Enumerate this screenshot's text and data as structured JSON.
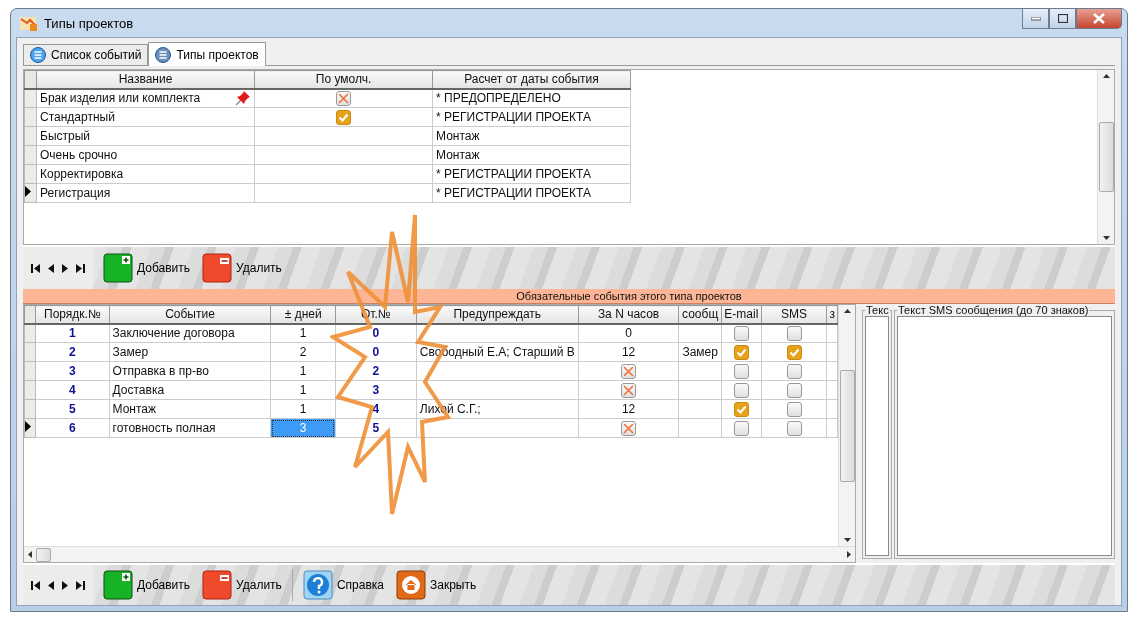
{
  "window": {
    "title": "Типы проектов"
  },
  "tabs": [
    {
      "label": "Список событий",
      "selected": false
    },
    {
      "label": "Типы проектов",
      "selected": true
    }
  ],
  "project_types": {
    "columns": [
      "Название",
      "По умолч.",
      "Расчет от даты события"
    ],
    "rows": [
      {
        "name": "Брак изделия или комплекта",
        "pinned": true,
        "default": {
          "kind": "cross"
        },
        "calc_from": "* ПРЕДОПРЕДЕЛЕНО",
        "selected": false
      },
      {
        "name": "Стандартный",
        "pinned": false,
        "default": {
          "kind": "check"
        },
        "calc_from": "* РЕГИСТРАЦИИ ПРОЕКТА",
        "selected": false
      },
      {
        "name": "Быстрый",
        "pinned": false,
        "calc_from": "Монтаж",
        "selected": false
      },
      {
        "name": "Очень срочно",
        "pinned": false,
        "calc_from": "Монтаж",
        "selected": false
      },
      {
        "name": "Корректировка",
        "pinned": false,
        "calc_from": "* РЕГИСТРАЦИИ ПРОЕКТА",
        "selected": false
      },
      {
        "name": "Регистрация",
        "pinned": false,
        "calc_from": "* РЕГИСТРАЦИИ ПРОЕКТА",
        "selected": true
      }
    ]
  },
  "top_toolbar": {
    "buttons": [
      {
        "kind": "add",
        "label": "Добавить"
      },
      {
        "kind": "delete",
        "label": "Удалить"
      }
    ]
  },
  "events_band": {
    "title": "Обязательные события этого типа проектов"
  },
  "events": {
    "columns": [
      "Порядк.№",
      "Событие",
      "± дней",
      "От.№",
      "Предупреждать",
      "За N часов",
      "сообщ",
      "E-mail",
      "SMS",
      "з"
    ],
    "rows": [
      {
        "order": "1",
        "event": "Заключение договора",
        "days": "1",
        "days_focused": false,
        "from": "0",
        "notify": "",
        "hours": {
          "kind": "text",
          "value": "0"
        },
        "message": "",
        "email": false,
        "sms": false,
        "selected": false
      },
      {
        "order": "2",
        "event": "Замер",
        "days": "2",
        "days_focused": false,
        "from": "0",
        "notify": "Свободный Е.А; Старший В",
        "hours": {
          "kind": "text",
          "value": "12"
        },
        "message": "Замер",
        "email": true,
        "sms": true,
        "selected": false
      },
      {
        "order": "3",
        "event": "Отправка в пр-во",
        "days": "1",
        "days_focused": false,
        "from": "2",
        "notify": "",
        "hours": {
          "kind": "cross"
        },
        "message": "",
        "email": false,
        "sms": false,
        "selected": false
      },
      {
        "order": "4",
        "event": "Доставка",
        "days": "1",
        "days_focused": false,
        "from": "3",
        "notify": "",
        "hours": {
          "kind": "cross"
        },
        "message": "",
        "email": false,
        "sms": false,
        "selected": false
      },
      {
        "order": "5",
        "event": "Монтаж",
        "days": "1",
        "days_focused": false,
        "from": "4",
        "notify": "Лихой С.Г.;",
        "hours": {
          "kind": "text",
          "value": "12"
        },
        "message": "",
        "email": true,
        "sms": false,
        "selected": false
      },
      {
        "order": "6",
        "event": "готовность полная",
        "days": "3",
        "days_focused": true,
        "from": "5",
        "notify": "",
        "hours": {
          "kind": "cross"
        },
        "message": "",
        "email": false,
        "sms": false,
        "selected": true
      }
    ]
  },
  "side_panels": [
    {
      "title": "Текс"
    },
    {
      "title": "Текст SMS сообщения (до 70 знаков)"
    }
  ],
  "bottom_toolbar": {
    "buttons": [
      {
        "kind": "add",
        "label": "Добавить"
      },
      {
        "kind": "delete",
        "label": "Удалить"
      },
      {
        "kind": "help",
        "label": "Справка"
      },
      {
        "kind": "close",
        "label": "Закрыть"
      }
    ]
  }
}
